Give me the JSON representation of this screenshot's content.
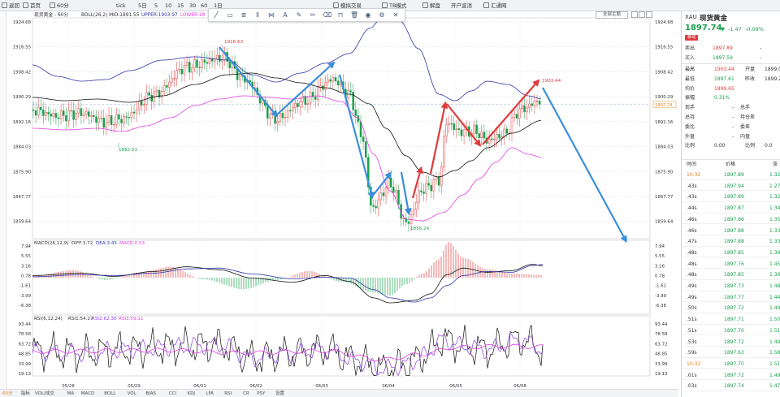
{
  "toolbar": {
    "items": [
      "返回",
      "首页",
      "60分",
      "tick",
      "5日",
      "5",
      "10",
      "15",
      "30",
      "60",
      "1日",
      "模拟交易",
      "TB模式",
      "解盘",
      "开户宣消",
      "汇通网"
    ]
  },
  "chart_header": {
    "symbol": "现货黄金 - 60分",
    "boll": "BOLL(26,2) MID:1891.55",
    "upper": "UPPER:1903.97",
    "lower": "LOWER:18"
  },
  "draw_toolbar": {
    "icons": [
      "line-tool-icon",
      "rect-tool-icon",
      "channel-tool-icon",
      "fib-tool-icon",
      "pattern-tool-icon",
      "text-tool-icon",
      "brush-tool-icon",
      "pencil-tool-icon",
      "eraser-tool-icon",
      "magnet-tool-icon",
      "trash-icon",
      "eye-icon",
      "settings-icon",
      "close-icon"
    ]
  },
  "chart_controls": {
    "main_button": "全部主题"
  },
  "colors": {
    "up": "#e03a3a",
    "down": "#18a04b",
    "boll_upper": "#2d35a8",
    "boll_mid": "#111111",
    "boll_lower": "#e040e0",
    "arrow_blue": "#3b8fd9",
    "arrow_red": "#e03a3a",
    "rsi2": "#8a3ee0",
    "rsi3": "#e040e0"
  },
  "chart_data": {
    "type": "candlestick",
    "x_ticks": [
      "05/28",
      "05/29",
      "06/01",
      "06/02",
      "06/03",
      "06/04",
      "06/05",
      "06/08"
    ],
    "price_axis": [
      "1924.68",
      "1916.55",
      "1908.42",
      "1900.29",
      "1892.16",
      "1884.03",
      "1875.90",
      "1867.77",
      "1859.64"
    ],
    "current_price": "1897.74",
    "price_range": [
      1854,
      1926
    ],
    "annotations": {
      "high1": "1916.63",
      "low1": "1882.51",
      "low2": "1856.24",
      "high2": "1903.44"
    },
    "indicators": {
      "macd": {
        "label": "MACD(26,12,9)",
        "diff": "DIFF:3.72",
        "dea": "DEA:3.45",
        "macd": "MACD:0.53",
        "axis": [
          "7.94",
          "5.55",
          "3.16",
          "0.78",
          "-1.61",
          "-3.99",
          "-6.38"
        ]
      },
      "rsi": {
        "label": "RSI(6,12,24)",
        "rsi1": "RSI1:54.27",
        "rsi2": "RSI2:62.36",
        "rsi3": "RSI3:59.11",
        "axis": [
          "93.44",
          "78.58",
          "63.72",
          "48.85",
          "33.99",
          "19.13"
        ]
      }
    }
  },
  "footer": {
    "items": [
      "60分",
      "指标",
      "VOL/成交",
      "MA",
      "MACD",
      "BOLL",
      "VOL",
      "BIAS",
      "CCI",
      "KDJ",
      "LFA",
      "RSI",
      "CR",
      "PSY",
      "设置"
    ]
  },
  "quote": {
    "code": "XAU",
    "name": "现货黄金",
    "price": "1897.74",
    "change": "-1.47",
    "change_pct": "-0.08%",
    "badge": "移动",
    "sell_label": "卖出",
    "sell": "1897.89",
    "buy_label": "买入",
    "buy": "1897.59",
    "dash": "-",
    "rows": [
      {
        "l1": "最高",
        "v1": "1903.44",
        "l2": "开盘",
        "v2": "1899.0"
      },
      {
        "l1": "最低",
        "v1": "1897.61",
        "l2": "昨收",
        "v2": "1899.2"
      },
      {
        "l1": "均价",
        "v1": "1899.65",
        "l2": "",
        "v2": ""
      },
      {
        "l1": "振幅",
        "v1": "0.31%",
        "l2": "",
        "v2": ""
      },
      {
        "l1": "现手",
        "v1": "-",
        "l2": "总手",
        "v2": ""
      },
      {
        "l1": "总持",
        "v1": "-",
        "l2": "持仓差",
        "v2": ""
      },
      {
        "l1": "委比",
        "v1": "-",
        "l2": "委差",
        "v2": ""
      },
      {
        "l1": "外盘",
        "v1": "-",
        "l2": "内盘",
        "v2": ""
      },
      {
        "l1": "比例",
        "v1": "0.00",
        "l2": "比例",
        "v2": "0.0"
      }
    ],
    "tick_headers": [
      "时间",
      "价格",
      "涨"
    ],
    "ticks": [
      {
        "t": "10:32",
        "p": "1897.89",
        "c": "1.32"
      },
      {
        "t": ".43s",
        "p": "1897.94",
        "c": "1.27"
      },
      {
        "t": ".43s",
        "p": "1897.89",
        "c": "1.32"
      },
      {
        "t": ".44s",
        "p": "1897.87",
        "c": "1.34"
      },
      {
        "t": ".46s",
        "p": "1897.86",
        "c": "1.35"
      },
      {
        "t": ".46s",
        "p": "1897.88",
        "c": "1.33"
      },
      {
        "t": ".47s",
        "p": "1897.88",
        "c": "1.33"
      },
      {
        "t": ".48s",
        "p": "1897.85",
        "c": "1.36"
      },
      {
        "t": ".48s",
        "p": "1897.76",
        "c": "1.45"
      },
      {
        "t": ".48s",
        "p": "1897.85",
        "c": "1.36"
      },
      {
        "t": ".49s",
        "p": "1897.73",
        "c": "1.48"
      },
      {
        "t": ".49s",
        "p": "1897.77",
        "c": "1.44"
      },
      {
        "t": ".50s",
        "p": "1897.72",
        "c": "1.49"
      },
      {
        "t": ".51s",
        "p": "1897.71",
        "c": "1.50"
      },
      {
        "t": ".51s",
        "p": "1897.70",
        "c": "1.51"
      },
      {
        "t": ".53s",
        "p": "1897.72",
        "c": "1.49"
      },
      {
        "t": ".59s",
        "p": "1897.63",
        "c": "1.58"
      },
      {
        "t": "10:32",
        "p": "1897.70",
        "c": "1.51"
      },
      {
        "t": ".01s",
        "p": "1897.72",
        "c": "1.49"
      },
      {
        "t": ".03s",
        "p": "1897.74",
        "c": "1.47"
      }
    ]
  }
}
